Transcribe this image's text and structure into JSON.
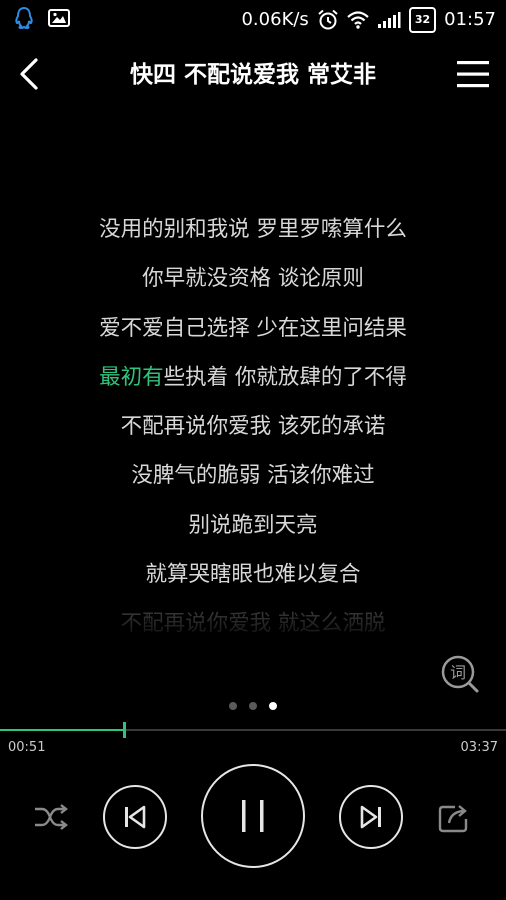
{
  "status_bar": {
    "speed": "0.06K/s",
    "battery": "32",
    "time": "01:57"
  },
  "header": {
    "title": "快四 不配说爱我 常艾非"
  },
  "lyrics": [
    {
      "text": "没用的别和我说 罗里罗嗦算什么"
    },
    {
      "text": "你早就没资格 谈论原则"
    },
    {
      "text": "爱不爱自己选择 少在这里问结果"
    },
    {
      "sung": "最初有",
      "rest": "些执着 你就放肆的了不得"
    },
    {
      "text": "不配再说你爱我 该死的承诺"
    },
    {
      "text": "没脾气的脆弱 活该你难过"
    },
    {
      "text": "别说跪到天亮"
    },
    {
      "text": "就算哭瞎眼也难以复合"
    },
    {
      "text": "不配再说你爱我 就这么洒脱"
    }
  ],
  "lyric_toggle_label": "词",
  "pager": {
    "count": 3,
    "active_index": 2
  },
  "player": {
    "elapsed": "00:51",
    "duration": "03:37",
    "progress_fraction": 0.246
  },
  "colors": {
    "accent": "#31c27c",
    "background": "#000000"
  },
  "icons": {
    "shuffle": "shuffle-icon",
    "prev": "previous-icon",
    "pause": "pause-icon",
    "next": "next-icon",
    "share": "share-icon"
  }
}
